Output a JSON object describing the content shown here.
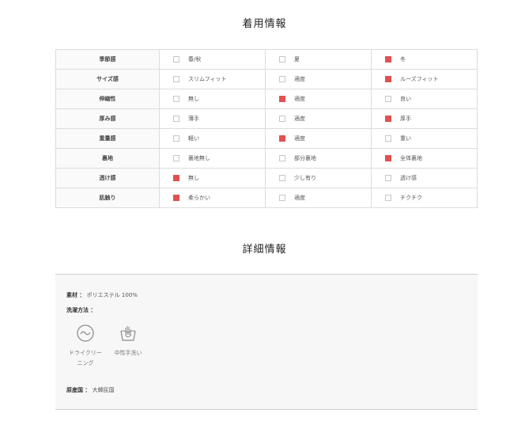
{
  "wear_info": {
    "title": "着用情報",
    "rows": [
      {
        "label": "季節感",
        "options": [
          {
            "text": "春/秋",
            "checked": false
          },
          {
            "text": "夏",
            "checked": false
          },
          {
            "text": "冬",
            "checked": true
          }
        ]
      },
      {
        "label": "サイズ感",
        "options": [
          {
            "text": "スリムフィット",
            "checked": false
          },
          {
            "text": "適度",
            "checked": false
          },
          {
            "text": "ルーズフィット",
            "checked": true
          }
        ]
      },
      {
        "label": "伸縮性",
        "options": [
          {
            "text": "無し",
            "checked": false
          },
          {
            "text": "適度",
            "checked": true
          },
          {
            "text": "良い",
            "checked": false
          }
        ]
      },
      {
        "label": "厚み感",
        "options": [
          {
            "text": "薄手",
            "checked": false
          },
          {
            "text": "適度",
            "checked": false
          },
          {
            "text": "厚手",
            "checked": true
          }
        ]
      },
      {
        "label": "重量感",
        "options": [
          {
            "text": "軽い",
            "checked": false
          },
          {
            "text": "適度",
            "checked": true
          },
          {
            "text": "重い",
            "checked": false
          }
        ]
      },
      {
        "label": "裏地",
        "options": [
          {
            "text": "裏地無し",
            "checked": false
          },
          {
            "text": "部分裏地",
            "checked": false
          },
          {
            "text": "全体裏地",
            "checked": true
          }
        ]
      },
      {
        "label": "透け感",
        "options": [
          {
            "text": "無し",
            "checked": true
          },
          {
            "text": "少し有り",
            "checked": false
          },
          {
            "text": "透け感",
            "checked": false
          }
        ]
      },
      {
        "label": "肌触り",
        "options": [
          {
            "text": "柔らかい",
            "checked": true
          },
          {
            "text": "適度",
            "checked": false
          },
          {
            "text": "チクチク",
            "checked": false
          }
        ]
      }
    ]
  },
  "detail_info": {
    "title": "詳細情報",
    "material_label": "素材 ：",
    "material_value": "ポリエステル 100%",
    "washing_label": "洗濯方法 ：",
    "care_icons": [
      {
        "icon": "dry-cleaning-icon",
        "label": "ドライクリーニング"
      },
      {
        "icon": "hand-wash-icon",
        "label": "中性手洗い"
      }
    ],
    "origin_label": "原産国 ：",
    "origin_value": "大韓民国"
  },
  "colors": {
    "checked": "#e0514f",
    "unchecked_border": "#c7c7c7"
  }
}
